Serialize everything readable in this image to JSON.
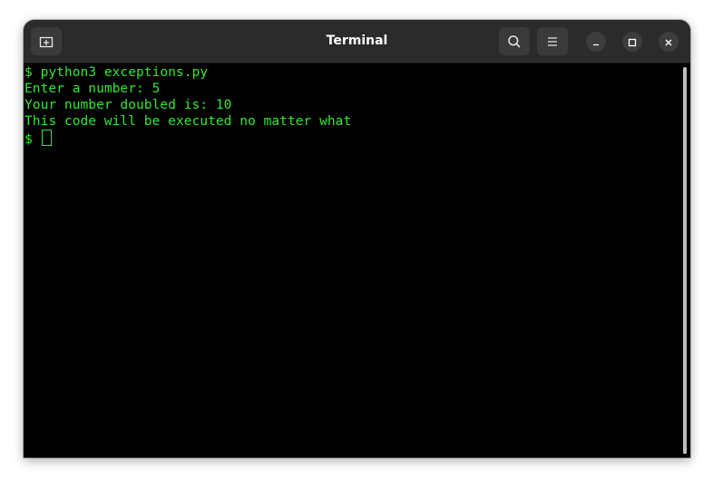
{
  "window": {
    "title": "Terminal",
    "buttons": {
      "new_tab_icon": "new-tab-icon",
      "search_icon": "search-icon",
      "menu_icon": "hamburger-menu-icon",
      "minimize_icon": "minimize-icon",
      "maximize_icon": "maximize-icon",
      "close_icon": "close-icon"
    }
  },
  "terminal": {
    "lines": [
      "$ python3 exceptions.py",
      "Enter a number: 5",
      "Your number doubled is: 10",
      "This code will be executed no matter what"
    ],
    "prompt": "$ ",
    "text_color": "#33e633",
    "background": "#000000"
  }
}
